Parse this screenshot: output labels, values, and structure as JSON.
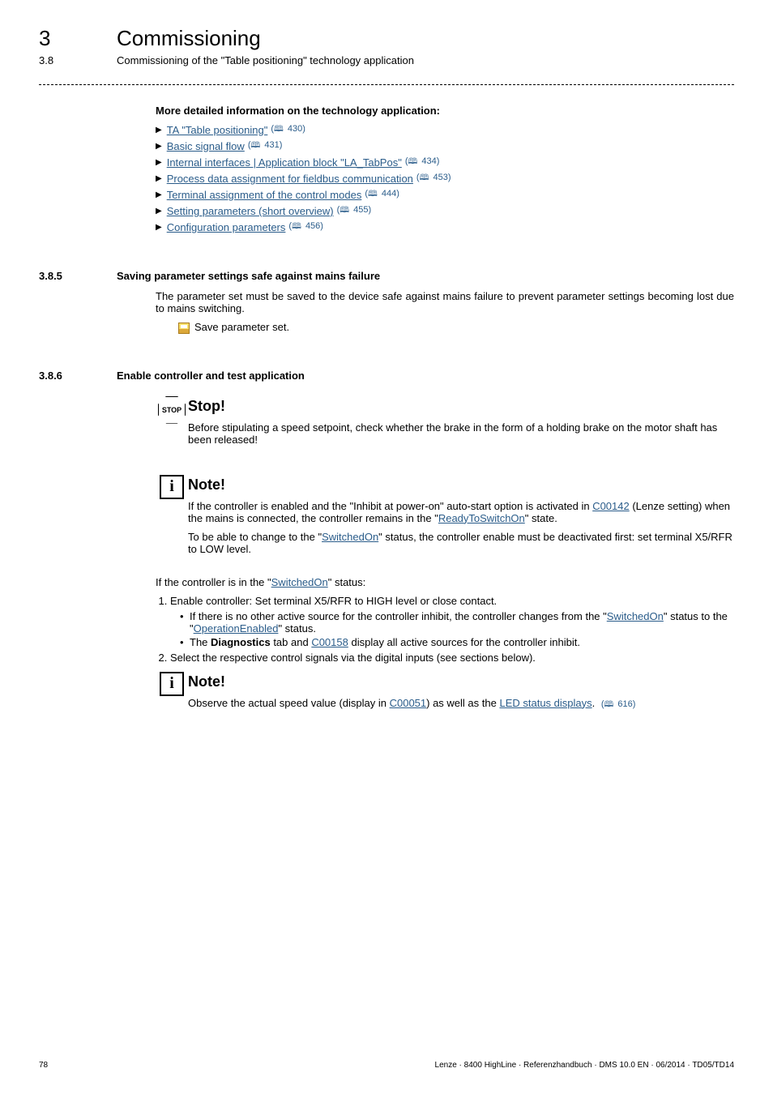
{
  "header": {
    "chapter_num": "3",
    "chapter_title": "Commissioning",
    "sub_num": "3.8",
    "sub_title": "Commissioning of the \"Table positioning\" technology application"
  },
  "intro": {
    "heading": "More detailed information on the technology application:",
    "links": [
      {
        "text": "TA \"Table positioning\"",
        "page": "430"
      },
      {
        "text": "Basic signal flow",
        "page": "431"
      },
      {
        "text": "Internal interfaces | Application block \"LA_TabPos\"",
        "page": "434"
      },
      {
        "text": "Process data assignment for fieldbus communication",
        "page": "453"
      },
      {
        "text": "Terminal assignment of the control modes",
        "page": "444"
      },
      {
        "text": "Setting parameters (short overview)",
        "page": "455"
      },
      {
        "text": "Configuration parameters",
        "page": "456"
      }
    ]
  },
  "sec385": {
    "num": "3.8.5",
    "title": "Saving parameter settings safe against mains failure",
    "para": "The parameter set must be saved to the device safe against mains failure to prevent parameter settings becoming lost due to mains switching.",
    "save": "Save parameter set."
  },
  "sec386": {
    "num": "3.8.6",
    "title": "Enable controller and test application",
    "stop": {
      "label": "STOP",
      "title": "Stop!",
      "text": "Before stipulating a speed setpoint, check whether the brake in the form of a holding brake on the motor shaft has been released!"
    },
    "note1": {
      "title": "Note!",
      "p1a": "If the controller is enabled and the \"Inhibit at power-on\" auto-start option is activated in ",
      "p1_link1": "C00142",
      "p1b": " (Lenze setting) when the mains is connected, the controller remains in the \"",
      "p1_link2": "ReadyToSwitchOn",
      "p1c": "\" state.",
      "p2a": "To be able to change to the \"",
      "p2_link": "SwitchedOn",
      "p2b": "\" status, the controller enable must be deactivated first: set terminal X5/RFR to LOW level."
    },
    "body": {
      "lead_a": "If the controller is in the \"",
      "lead_link": "SwitchedOn",
      "lead_b": "\" status:",
      "ol1": "Enable controller: Set terminal X5/RFR to HIGH level or close contact.",
      "ul1a": "If there is no other active source for the controller inhibit, the controller changes from the \"",
      "ul1_link1": "SwitchedOn",
      "ul1b": "\" status to the \"",
      "ul1_link2": "OperationEnabled",
      "ul1c": "\" status.",
      "ul2a": "The ",
      "ul2_bold": "Diagnostics",
      "ul2b": " tab and ",
      "ul2_link": "C00158",
      "ul2c": " display all active sources for the controller inhibit.",
      "ol2": "Select the respective control signals via the digital inputs (see sections below)."
    },
    "note2": {
      "title": "Note!",
      "a": "Observe the actual speed value (display in ",
      "link1": "C00051",
      "b": ") as well as the ",
      "link2": "LED status displays",
      "c": ". ",
      "page": "616"
    }
  },
  "footer": {
    "page": "78",
    "info": "Lenze · 8400 HighLine · Referenzhandbuch · DMS 10.0 EN · 06/2014 · TD05/TD14"
  }
}
